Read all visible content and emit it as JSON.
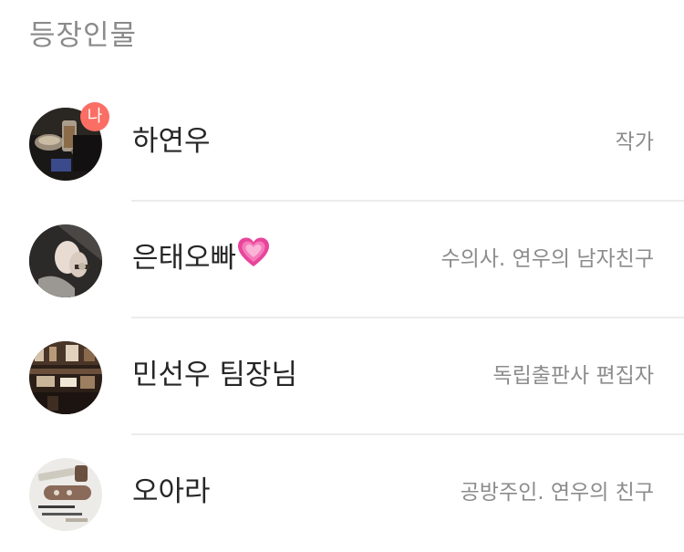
{
  "section": {
    "title": "등장인물"
  },
  "characters": [
    {
      "name": "하연우",
      "role": "작가",
      "badge": "나",
      "avatar_icon": "cafe-photo-avatar"
    },
    {
      "name": "은태오빠",
      "role": "수의사. 연우의 남자친구",
      "emoji_icon": "growing-heart-emoji",
      "avatar_icon": "holding-hands-photo-avatar"
    },
    {
      "name": "민선우 팀장님",
      "role": "독립출판사 편집자",
      "avatar_icon": "bookstore-photo-avatar"
    },
    {
      "name": "오아라",
      "role": "공방주인. 연우의 친구",
      "avatar_icon": "craft-tools-photo-avatar"
    }
  ]
}
